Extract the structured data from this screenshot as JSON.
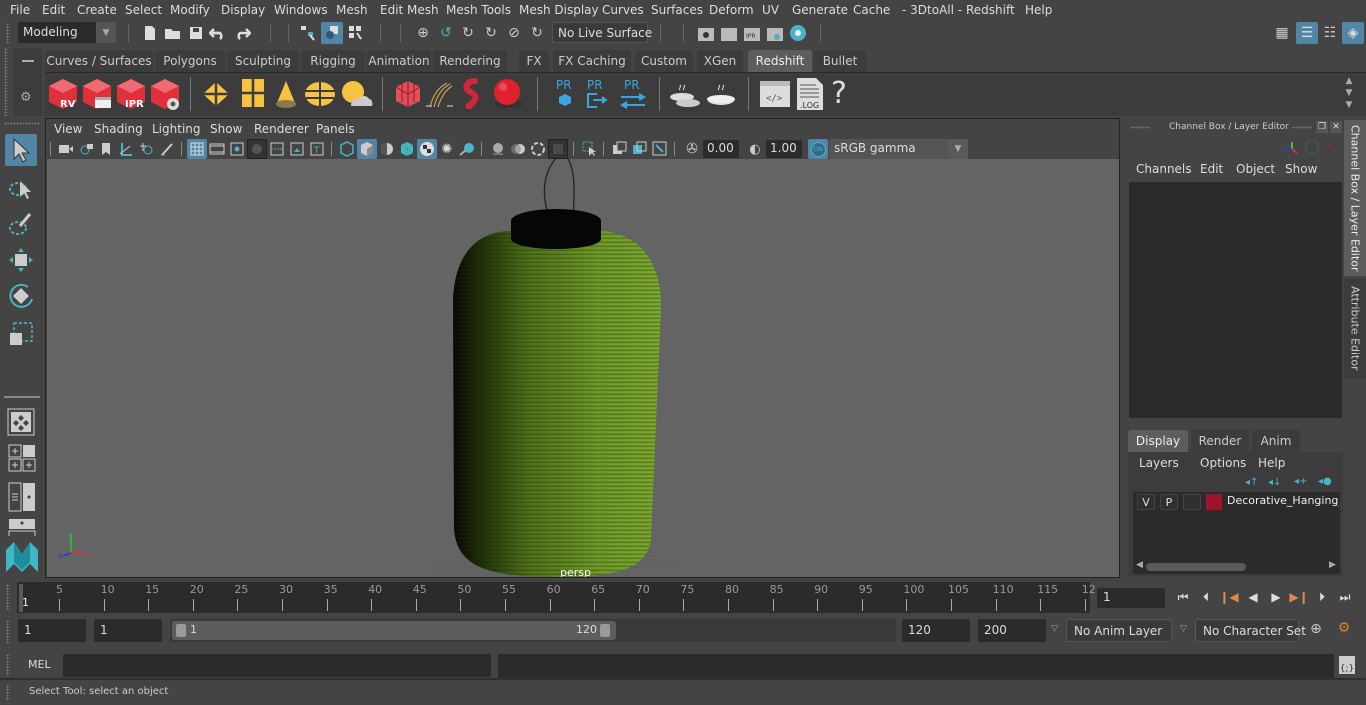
{
  "menubar": {
    "items": [
      "File",
      "Edit",
      "Create",
      "Select",
      "Modify",
      "Display",
      "Windows",
      "Mesh",
      "Edit Mesh",
      "Mesh Tools",
      "Mesh Display",
      "Curves",
      "Surfaces",
      "Deform",
      "UV",
      "Generate",
      "Cache",
      "- 3DtoAll -",
      "Redshift",
      "Help"
    ]
  },
  "statusline": {
    "workspace": "Modeling",
    "live_surface": "No Live Surface"
  },
  "shelf": {
    "tabs": [
      "Curves / Surfaces",
      "Polygons",
      "Sculpting",
      "Rigging",
      "Animation",
      "Rendering",
      "FX",
      "FX Caching",
      "Custom",
      "XGen",
      "Redshift",
      "Bullet"
    ],
    "active_tab": "Redshift",
    "icons": [
      {
        "name": "rs-render-view-icon",
        "label": "RV"
      },
      {
        "name": "rs-batch-render-icon",
        "label": ""
      },
      {
        "name": "rs-ipr-icon",
        "label": "IPR"
      },
      {
        "name": "rs-render-settings-icon",
        "label": ""
      },
      {
        "name": "rs-area-light-icon",
        "label": ""
      },
      {
        "name": "rs-portal-light-icon",
        "label": ""
      },
      {
        "name": "rs-spot-light-icon",
        "label": ""
      },
      {
        "name": "rs-dome-light-icon",
        "label": ""
      },
      {
        "name": "rs-sun-sky-icon",
        "label": ""
      },
      {
        "name": "rs-proxy-icon",
        "label": ""
      },
      {
        "name": "rs-hair-icon",
        "label": ""
      },
      {
        "name": "rs-volume-icon",
        "label": ""
      },
      {
        "name": "rs-sphere-icon",
        "label": ""
      },
      {
        "name": "rs-pr-object-icon",
        "label": "PR"
      },
      {
        "name": "rs-pr-export-icon",
        "label": "PR"
      },
      {
        "name": "rs-pr-exchange-icon",
        "label": "PR"
      },
      {
        "name": "rs-bake-multi-icon",
        "label": ""
      },
      {
        "name": "rs-bake-icon",
        "label": ""
      },
      {
        "name": "rs-script-icon",
        "label": "</>"
      },
      {
        "name": "rs-log-icon",
        "label": ".LOG"
      },
      {
        "name": "rs-help-icon",
        "label": "?"
      }
    ]
  },
  "viewport": {
    "menu": [
      "View",
      "Shading",
      "Lighting",
      "Show",
      "Renderer",
      "Panels"
    ],
    "exposure": "0.00",
    "gamma": "1.00",
    "color_mgmt_badge": "ON",
    "color_space": "sRGB gamma",
    "camera_label": "persp",
    "axis": {
      "x": "x",
      "y": "y",
      "z": "z"
    }
  },
  "channel_box": {
    "title": "Channel Box / Layer Editor",
    "menu": [
      "Channels",
      "Edit",
      "Object",
      "Show"
    ]
  },
  "layer_editor": {
    "tabs": [
      "Display",
      "Render",
      "Anim"
    ],
    "active_tab": "Display",
    "menu": [
      "Layers",
      "Options",
      "Help"
    ],
    "layers": [
      {
        "v": "V",
        "p": "P",
        "color": "#a0132f",
        "name": "Decorative_Hanging_C"
      }
    ]
  },
  "side_tabs": [
    "Channel Box / Layer Editor",
    "Attribute Editor"
  ],
  "timeline": {
    "ticks": [
      "5",
      "10",
      "15",
      "20",
      "25",
      "30",
      "35",
      "40",
      "45",
      "50",
      "55",
      "60",
      "65",
      "70",
      "75",
      "80",
      "85",
      "90",
      "95",
      "100",
      "105",
      "110",
      "115",
      "12"
    ],
    "current_frame_marker": "1",
    "current_frame": "1"
  },
  "range": {
    "start": "1",
    "playback_start": "1",
    "slider_start": "1",
    "slider_end": "120",
    "playback_end": "120",
    "end": "200",
    "anim_layer": "No Anim Layer",
    "character_set": "No Character Set"
  },
  "command_line": {
    "language": "MEL",
    "input": "",
    "output": ""
  },
  "help_line": {
    "text": "Select Tool: select an object"
  },
  "colors": {
    "accent": "#5285a6",
    "lantern_green": "#6e9a27",
    "layer_color": "#a0132f",
    "rs_red": "#e0303c",
    "rs_yellow": "#f5c342",
    "pr_blue": "#3aa6e0"
  }
}
